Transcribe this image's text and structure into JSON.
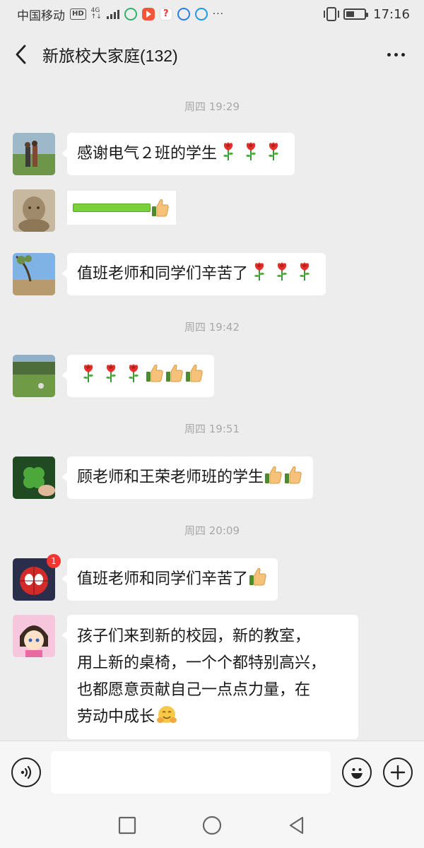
{
  "status_bar": {
    "carrier": "中国移动",
    "hd": "HD",
    "net_top": "4G",
    "net_bottom": "↑↓",
    "more": "···",
    "time": "17:16",
    "battery_level": 0.45
  },
  "header": {
    "title": "新旅校大家庭(132)"
  },
  "messages": {
    "sep1": "周四 19:29",
    "m1_text": "感谢电气２班的学生",
    "m3_text": "值班老师和同学们辛苦了",
    "sep2": "周四 19:42",
    "sep3": "周四 19:51",
    "m5_text": "顾老师和王荣老师班的学生",
    "sep4": "周四 20:09",
    "m6_text": "值班老师和同学们辛苦了",
    "m6_badge": "1",
    "m7_lines": [
      "孩子们来到新的校园，新的教室，",
      "用上新的桌椅，一个个都特别高兴，",
      "也都愿意贡献自己一点点力量，在",
      "劳动中成长"
    ]
  },
  "emoji": {
    "rose": "rose-icon",
    "thumb": "thumbs-up-icon",
    "hug": "hugging-face-icon"
  },
  "input": {
    "placeholder": ""
  },
  "colors": {
    "background": "#ededed",
    "bubble": "#ffffff",
    "badge": "#f43530",
    "timestamp": "#a8a8a8"
  }
}
